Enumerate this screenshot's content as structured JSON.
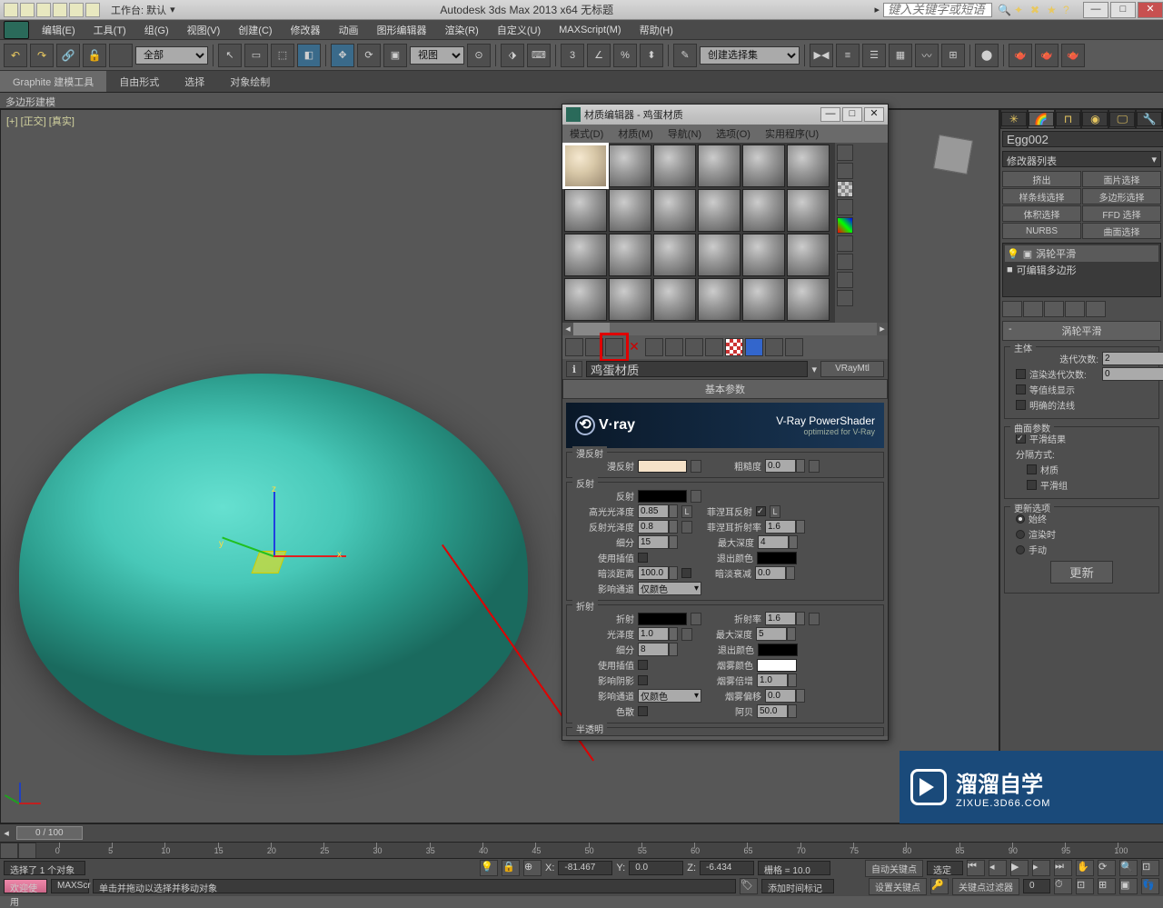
{
  "titlebar": {
    "workspace_label": "工作台: 默认",
    "app_title": "Autodesk 3ds Max  2013 x64   无标题",
    "search_placeholder": "键入关键字或短语"
  },
  "menubar": {
    "items": [
      "编辑(E)",
      "工具(T)",
      "组(G)",
      "视图(V)",
      "创建(C)",
      "修改器",
      "动画",
      "图形编辑器",
      "渲染(R)",
      "自定义(U)",
      "MAXScript(M)",
      "帮助(H)"
    ]
  },
  "toolbar": {
    "filter_all": "全部",
    "view_dropdown": "视图",
    "selection_set": "创建选择集"
  },
  "ribbon": {
    "tabs": [
      "Graphite 建模工具",
      "自由形式",
      "选择",
      "对象绘制"
    ],
    "sub": "多边形建模"
  },
  "viewport": {
    "label": "[+] [正交] [真实]",
    "axes": {
      "x": "x",
      "y": "y",
      "z": "z"
    }
  },
  "cmd_panel": {
    "obj_name": "Egg002",
    "modifier_list": "修改器列表",
    "so_buttons": [
      "挤出",
      "面片选择",
      "样条线选择",
      "多边形选择",
      "体积选择",
      "FFD 选择",
      "NURBS",
      "曲面选择"
    ],
    "stack": [
      "涡轮平滑",
      "可编辑多边形"
    ],
    "rollout_title": "涡轮平滑",
    "main_group": "主体",
    "iterations_label": "迭代次数:",
    "iterations_value": "2",
    "render_iters_label": "渲染迭代次数:",
    "render_iters_value": "0",
    "isoline_label": "等值线显示",
    "explicit_label": "明确的法线",
    "surface_group": "曲面参数",
    "smooth_result_label": "平滑结果",
    "sep_by_label": "分隔方式:",
    "by_mat_label": "材质",
    "by_smg_label": "平滑组",
    "update_group": "更新选项",
    "upd_always": "始终",
    "upd_render": "渲染时",
    "upd_manual": "手动",
    "update_btn": "更新"
  },
  "mat_editor": {
    "title": "材质编辑器 - 鸡蛋材质",
    "menu": [
      "模式(D)",
      "材质(M)",
      "导航(N)",
      "选项(O)",
      "实用程序(U)"
    ],
    "mat_name": "鸡蛋材质",
    "mat_type": "VRayMtl",
    "basic_params": "基本参数",
    "vray_brand": "V·ray",
    "vray_ps1": "V-Ray PowerShader",
    "vray_ps2": "optimized for V-Ray",
    "grp_diffuse": "漫反射",
    "diffuse_label": "漫反射",
    "roughness_label": "粗糙度",
    "roughness_value": "0.0",
    "grp_reflect": "反射",
    "reflect_label": "反射",
    "hilight_label": "高光光泽度",
    "hilight_value": "0.85",
    "refl_gloss_label": "反射光泽度",
    "refl_gloss_value": "0.8",
    "subdivs_label": "细分",
    "subdivs_value": "15",
    "use_interp_label": "使用插值",
    "dim_dist_label": "暗淡距离",
    "dim_dist_value": "100.0",
    "affect_chan_label": "影响通道",
    "affect_chan_val": "仅颜色",
    "fresnel_label": "菲涅耳反射",
    "fresnel_ior_label": "菲涅耳折射率",
    "fresnel_ior_value": "1.6",
    "max_depth_label": "最大深度",
    "max_depth_value": "4",
    "exit_color_label": "退出颜色",
    "dim_falloff_label": "暗淡衰减",
    "dim_falloff_value": "0.0",
    "l_button": "L",
    "grp_refract": "折射",
    "refract_label": "折射",
    "glossiness_label": "光泽度",
    "glossiness_value": "1.0",
    "refr_subdiv_label": "细分",
    "refr_subdiv_value": "8",
    "refr_interp_label": "使用插值",
    "affect_shadow_label": "影响阴影",
    "refr_affect_label": "影响通道",
    "refr_affect_val": "仅颜色",
    "ior_label": "折射率",
    "ior_value": "1.6",
    "refr_depth_label": "最大深度",
    "refr_depth_value": "5",
    "refr_exit_label": "退出颜色",
    "fog_color_label": "烟雾颜色",
    "fog_mult_label": "烟雾倍增",
    "fog_mult_value": "1.0",
    "fog_bias_label": "烟雾偏移",
    "fog_bias_value": "0.0",
    "dispersion_label": "色散",
    "abbe_label": "阿贝",
    "abbe_value": "50.0",
    "translucency": "半透明"
  },
  "timeslider": {
    "label": "0 / 100"
  },
  "trackbar_ticks": [
    "0",
    "5",
    "10",
    "15",
    "20",
    "25",
    "30",
    "35",
    "40",
    "45",
    "50",
    "55",
    "60",
    "65",
    "70",
    "75",
    "80",
    "85",
    "90",
    "95",
    "100"
  ],
  "status": {
    "welcome": "欢迎使用",
    "maxscr": "MAXScr",
    "sel_text": "选择了 1 个对象",
    "prompt": "单击并拖动以选择并移动对象",
    "x_label": "X:",
    "x_val": "-81.467",
    "y_label": "Y:",
    "y_val": "0.0",
    "z_label": "Z:",
    "z_val": "-6.434",
    "grid": "栅格 = 10.0",
    "add_time_tag": "添加时间标记",
    "autokey": "自动关键点",
    "selset": "选定对",
    "setkey": "设置关键点",
    "keyfilter": "关键点过滤器"
  },
  "watermark": {
    "cn": "溜溜自学",
    "en": "ZIXUE.3D66.COM"
  }
}
